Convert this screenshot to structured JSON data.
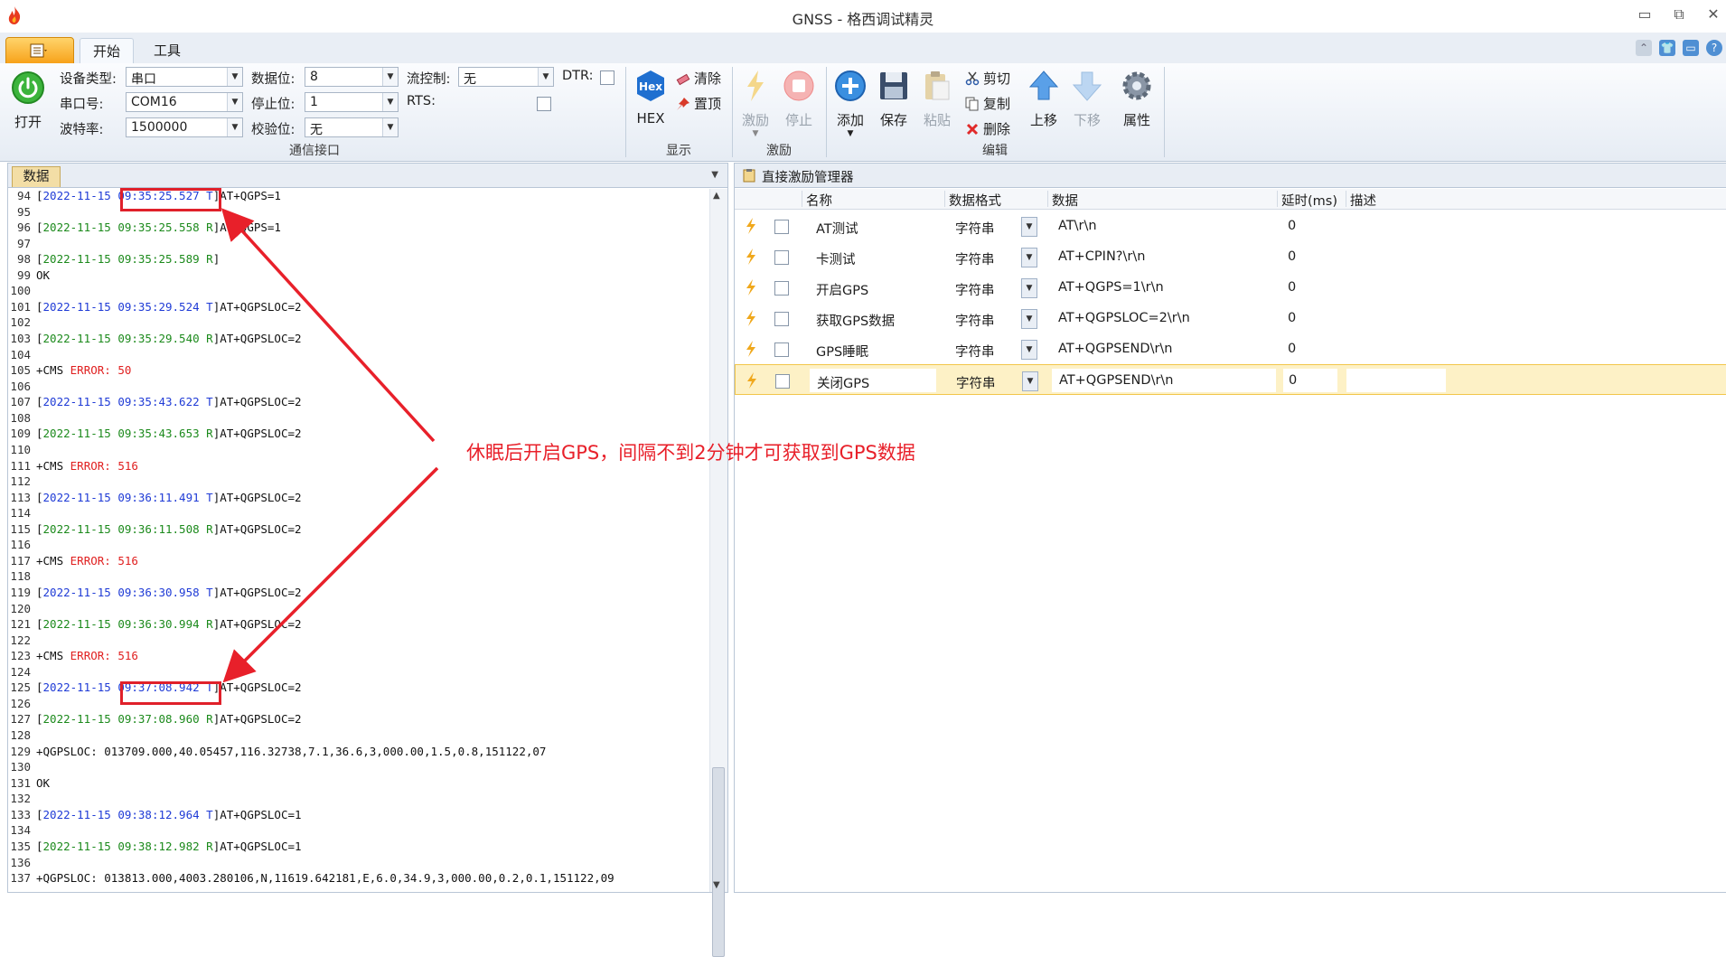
{
  "window": {
    "title": "GNSS - 格西调试精灵",
    "controls": {
      "minimize": "▭",
      "restore": "⧉",
      "close": "✕"
    }
  },
  "ribbon_tabs": [
    {
      "label": "开始",
      "active": true
    },
    {
      "label": "工具",
      "active": false
    }
  ],
  "comm": {
    "open_label": "打开",
    "device_type_label": "设备类型:",
    "device_type_value": "串口",
    "port_label": "串口号:",
    "port_value": "COM16",
    "baud_label": "波特率:",
    "baud_value": "1500000",
    "data_bits_label": "数据位:",
    "data_bits_value": "8",
    "stop_bits_label": "停止位:",
    "stop_bits_value": "1",
    "parity_label": "校验位:",
    "parity_value": "无",
    "flow_label": "流控制:",
    "flow_value": "无",
    "dtr_label": "DTR:",
    "rts_label": "RTS:",
    "group_label": "通信接口"
  },
  "display": {
    "hex_label": "HEX",
    "hex_icon_text": "Hex",
    "clear_label": "清除",
    "top_label": "置顶",
    "group_label": "显示"
  },
  "stimulus": {
    "excite_label": "激励",
    "stop_label": "停止",
    "group_label": "激励"
  },
  "edit": {
    "add_label": "添加",
    "save_label": "保存",
    "paste_label": "粘贴",
    "cut_label": "剪切",
    "copy_label": "复制",
    "delete_label": "删除",
    "up_label": "上移",
    "down_label": "下移",
    "props_label": "属性",
    "group_label": "编辑"
  },
  "left_panel": {
    "tab_label": "数据"
  },
  "log_lines": [
    {
      "n": "94",
      "parts": [
        {
          "t": "[",
          "c": "bk"
        },
        {
          "t": "2022-11-15 ",
          "c": "bl"
        },
        {
          "t": "09:35:25.527",
          "c": "bl"
        },
        {
          "t": " T",
          "c": "bl"
        },
        {
          "t": "]AT+QGPS=1",
          "c": "bk"
        }
      ]
    },
    {
      "n": "95",
      "parts": []
    },
    {
      "n": "96",
      "parts": [
        {
          "t": "[",
          "c": "bk"
        },
        {
          "t": "2022-11-15 09:35:25.558 R",
          "c": "gr"
        },
        {
          "t": "]AT+QGPS=1",
          "c": "bk"
        }
      ]
    },
    {
      "n": "97",
      "parts": []
    },
    {
      "n": "98",
      "parts": [
        {
          "t": "[",
          "c": "bk"
        },
        {
          "t": "2022-11-15 09:35:25.589 R",
          "c": "gr"
        },
        {
          "t": "]",
          "c": "bk"
        }
      ]
    },
    {
      "n": "99",
      "parts": [
        {
          "t": "OK",
          "c": "bk"
        }
      ]
    },
    {
      "n": "100",
      "parts": []
    },
    {
      "n": "101",
      "parts": [
        {
          "t": "[",
          "c": "bk"
        },
        {
          "t": "2022-11-15 09:35:29.524 T",
          "c": "bl"
        },
        {
          "t": "]AT+QGPSLOC=2",
          "c": "bk"
        }
      ]
    },
    {
      "n": "102",
      "parts": []
    },
    {
      "n": "103",
      "parts": [
        {
          "t": "[",
          "c": "bk"
        },
        {
          "t": "2022-11-15 09:35:29.540 R",
          "c": "gr"
        },
        {
          "t": "]AT+QGPSLOC=2",
          "c": "bk"
        }
      ]
    },
    {
      "n": "104",
      "parts": []
    },
    {
      "n": "105",
      "parts": [
        {
          "t": "+CMS ",
          "c": "bk"
        },
        {
          "t": "ERROR: 50",
          "c": "rd"
        }
      ]
    },
    {
      "n": "106",
      "parts": []
    },
    {
      "n": "107",
      "parts": [
        {
          "t": "[",
          "c": "bk"
        },
        {
          "t": "2022-11-15 09:35:43.622 T",
          "c": "bl"
        },
        {
          "t": "]AT+QGPSLOC=2",
          "c": "bk"
        }
      ]
    },
    {
      "n": "108",
      "parts": []
    },
    {
      "n": "109",
      "parts": [
        {
          "t": "[",
          "c": "bk"
        },
        {
          "t": "2022-11-15 09:35:43.653 R",
          "c": "gr"
        },
        {
          "t": "]AT+QGPSLOC=2",
          "c": "bk"
        }
      ]
    },
    {
      "n": "110",
      "parts": []
    },
    {
      "n": "111",
      "parts": [
        {
          "t": "+CMS ",
          "c": "bk"
        },
        {
          "t": "ERROR: 516",
          "c": "rd"
        }
      ]
    },
    {
      "n": "112",
      "parts": []
    },
    {
      "n": "113",
      "parts": [
        {
          "t": "[",
          "c": "bk"
        },
        {
          "t": "2022-11-15 09:36:11.491 T",
          "c": "bl"
        },
        {
          "t": "]AT+QGPSLOC=2",
          "c": "bk"
        }
      ]
    },
    {
      "n": "114",
      "parts": []
    },
    {
      "n": "115",
      "parts": [
        {
          "t": "[",
          "c": "bk"
        },
        {
          "t": "2022-11-15 09:36:11.508 R",
          "c": "gr"
        },
        {
          "t": "]AT+QGPSLOC=2",
          "c": "bk"
        }
      ]
    },
    {
      "n": "116",
      "parts": []
    },
    {
      "n": "117",
      "parts": [
        {
          "t": "+CMS ",
          "c": "bk"
        },
        {
          "t": "ERROR: 516",
          "c": "rd"
        }
      ]
    },
    {
      "n": "118",
      "parts": []
    },
    {
      "n": "119",
      "parts": [
        {
          "t": "[",
          "c": "bk"
        },
        {
          "t": "2022-11-15 09:36:30.958 T",
          "c": "bl"
        },
        {
          "t": "]AT+QGPSLOC=2",
          "c": "bk"
        }
      ]
    },
    {
      "n": "120",
      "parts": []
    },
    {
      "n": "121",
      "parts": [
        {
          "t": "[",
          "c": "bk"
        },
        {
          "t": "2022-11-15 09:36:30.994 R",
          "c": "gr"
        },
        {
          "t": "]AT+QGPSLOC=2",
          "c": "bk"
        }
      ]
    },
    {
      "n": "122",
      "parts": []
    },
    {
      "n": "123",
      "parts": [
        {
          "t": "+CMS ",
          "c": "bk"
        },
        {
          "t": "ERROR: 516",
          "c": "rd"
        }
      ]
    },
    {
      "n": "124",
      "parts": []
    },
    {
      "n": "125",
      "parts": [
        {
          "t": "[",
          "c": "bk"
        },
        {
          "t": "2022-11-15 ",
          "c": "bl"
        },
        {
          "t": "09:37:08.942",
          "c": "bl"
        },
        {
          "t": " T",
          "c": "bl"
        },
        {
          "t": "]AT+QGPSLOC=2",
          "c": "bk"
        }
      ]
    },
    {
      "n": "126",
      "parts": []
    },
    {
      "n": "127",
      "parts": [
        {
          "t": "[",
          "c": "bk"
        },
        {
          "t": "2022-11-15 09:37:08.960 R",
          "c": "gr"
        },
        {
          "t": "]AT+QGPSLOC=2",
          "c": "bk"
        }
      ]
    },
    {
      "n": "128",
      "parts": []
    },
    {
      "n": "129",
      "parts": [
        {
          "t": "+QGPSLOC: 013709.000,40.05457,116.32738,7.1,36.6,3,000.00,1.5,0.8,151122,07",
          "c": "bk"
        }
      ]
    },
    {
      "n": "130",
      "parts": []
    },
    {
      "n": "131",
      "parts": [
        {
          "t": "OK",
          "c": "bk"
        }
      ]
    },
    {
      "n": "132",
      "parts": []
    },
    {
      "n": "133",
      "parts": [
        {
          "t": "[",
          "c": "bk"
        },
        {
          "t": "2022-11-15 09:38:12.964 T",
          "c": "bl"
        },
        {
          "t": "]AT+QGPSLOC=1",
          "c": "bk"
        }
      ]
    },
    {
      "n": "134",
      "parts": []
    },
    {
      "n": "135",
      "parts": [
        {
          "t": "[",
          "c": "bk"
        },
        {
          "t": "2022-11-15 09:38:12.982 R",
          "c": "gr"
        },
        {
          "t": "]AT+QGPSLOC=1",
          "c": "bk"
        }
      ]
    },
    {
      "n": "136",
      "parts": []
    },
    {
      "n": "137",
      "parts": [
        {
          "t": "+QGPSLOC: 013813.000,4003.280106,N,11619.642181,E,6.0,34.9,3,000.00,0.2,0.1,151122,09",
          "c": "bk"
        }
      ]
    }
  ],
  "right_panel": {
    "title": "直接激励管理器",
    "columns": [
      "名称",
      "数据格式",
      "数据",
      "延时(ms)",
      "描述"
    ],
    "rows": [
      {
        "name": "AT测试",
        "format": "字符串",
        "data": "AT\\r\\n",
        "delay": "0",
        "desc": ""
      },
      {
        "name": "卡测试",
        "format": "字符串",
        "data": "AT+CPIN?\\r\\n",
        "delay": "0",
        "desc": ""
      },
      {
        "name": "开启GPS",
        "format": "字符串",
        "data": "AT+QGPS=1\\r\\n",
        "delay": "0",
        "desc": ""
      },
      {
        "name": "获取GPS数据",
        "format": "字符串",
        "data": "AT+QGPSLOC=2\\r\\n",
        "delay": "0",
        "desc": ""
      },
      {
        "name": "GPS睡眠",
        "format": "字符串",
        "data": "AT+QGPSEND\\r\\n",
        "delay": "0",
        "desc": ""
      },
      {
        "name": "关闭GPS",
        "format": "字符串",
        "data": "AT+QGPSEND\\r\\n",
        "delay": "0",
        "desc": ""
      }
    ],
    "selected_row": 5
  },
  "annotation": {
    "text": "休眠后开启GPS，间隔不到2分钟才可获取到GPS数据",
    "color": "#e8202a"
  },
  "colors": {
    "accent_blue": "#1f3bd6",
    "receive_green": "#1c8a1c",
    "error_red": "#e01f1f",
    "file_tab_orange": "#f7a21a"
  }
}
